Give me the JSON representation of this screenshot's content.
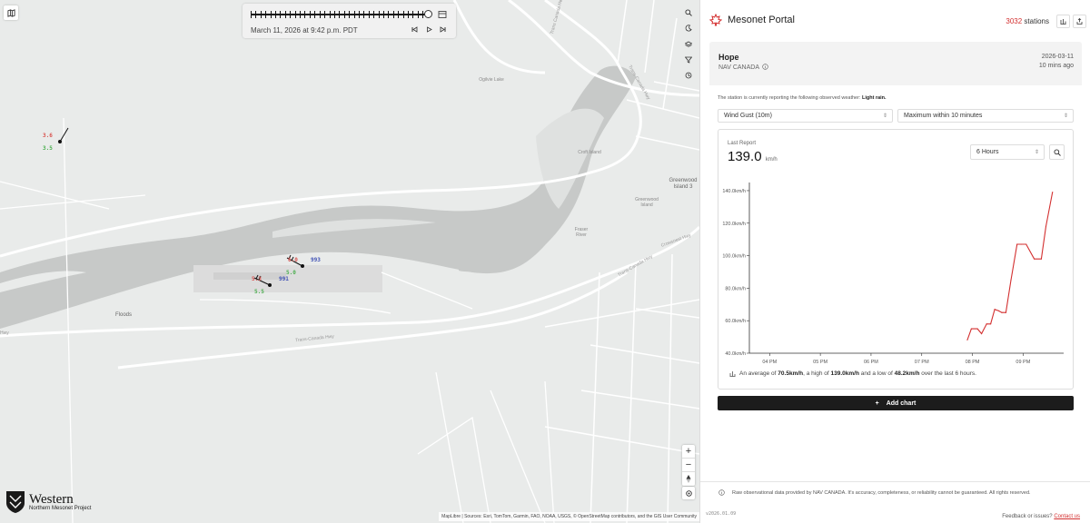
{
  "map": {
    "place_labels": [
      "Floods",
      "Croft Island",
      "Greenwood Island",
      "Greenwood Island 3",
      "Fraser River",
      "Ogilvie Lake"
    ],
    "road_labels": [
      "Trans-Canada Hwy",
      "Trans-Canada Hwy",
      "Trans-Canada Hwy",
      "Crowsnest Hwy",
      "Trans Canada Hwy",
      "Hwy"
    ],
    "stations": [
      {
        "temp": "3.6",
        "dew": "3.5"
      },
      {
        "temp": "6.0",
        "dew": "5.0",
        "pressure": "993"
      },
      {
        "temp": "5.3",
        "dew": "5.5",
        "pressure": "991"
      }
    ],
    "logo": {
      "title": "Western",
      "subtitle": "Northern Mesonet Project"
    },
    "attribution": "MapLibre | Sources: Esri, TomTom, Garmin, FAO, NOAA, USGS, © OpenStreetMap contributors, and the GIS User Community"
  },
  "timeline": {
    "timestamp": "March 11, 2026 at 9:42 p.m. PDT",
    "progress": 1.0
  },
  "icons": {
    "timeline": [
      "calendar-icon",
      "skip-back-icon",
      "play-icon",
      "skip-forward-icon"
    ],
    "map_tools": [
      "search-icon",
      "dark-mode-icon",
      "layers-icon",
      "filter-icon",
      "history-icon"
    ],
    "zoom": [
      "zoom-in-icon",
      "zoom-out-icon",
      "compass-icon",
      "locate-icon"
    ]
  },
  "header": {
    "app_title": "Mesonet Portal",
    "station_count": "3032",
    "station_suffix": "stations",
    "brand_color": "#d32f2f"
  },
  "station": {
    "name": "Hope",
    "network": "NAV CANADA",
    "date": "2026-03-11",
    "ago": "10 mins ago",
    "weather_prefix": "The station is currently reporting the following observed weather:",
    "weather_value": "Light rain."
  },
  "controls": {
    "variable": "Wind Gust (10m)",
    "aggregation": "Maximum within 10 minutes",
    "range": "6 Hours"
  },
  "card": {
    "last_report_label": "Last Report",
    "last_value": "139.0",
    "unit": "km/h",
    "summary_a": "An average of",
    "avg": "70.5km/h",
    "summary_b": ", a high of",
    "high": "139.0km/h",
    "summary_c": "and a low of",
    "low": "48.2km/h",
    "summary_d": "over the last 6 hours."
  },
  "add_chart_label": "Add chart",
  "footer": {
    "disclaimer": "Raw observational data provided by NAV CANADA. It's accuracy, completeness, or reliability cannot be guaranteed. All rights reserved.",
    "version": "v2026.01.09",
    "feedback": "Feedback or issues?",
    "contact": "Contact us"
  },
  "chart_data": {
    "type": "line",
    "title": "",
    "xlabel": "",
    "ylabel": "",
    "x_ticks": [
      "04 PM",
      "05 PM",
      "06 PM",
      "07 PM",
      "08 PM",
      "09 PM"
    ],
    "y_ticks": [
      "40.0km/h",
      "60.0km/h",
      "80.0km/h",
      "100.0km/h",
      "120.0km/h",
      "140.0km/h"
    ],
    "ylim": [
      40,
      145
    ],
    "xlim_hours": [
      15.6,
      21.8
    ],
    "grid": false,
    "series": [
      {
        "color": "#d32f2f",
        "x": [
          19.9,
          19.98,
          20.1,
          20.18,
          20.28,
          20.36,
          20.44,
          20.52,
          20.58,
          20.66,
          20.76,
          20.88,
          20.96,
          21.06,
          21.22,
          21.36,
          21.45,
          21.58
        ],
        "values": [
          48.2,
          55,
          55,
          52,
          58,
          58,
          67,
          66,
          65,
          65,
          85,
          107,
          107,
          107,
          98,
          98,
          118,
          139
        ]
      }
    ]
  }
}
